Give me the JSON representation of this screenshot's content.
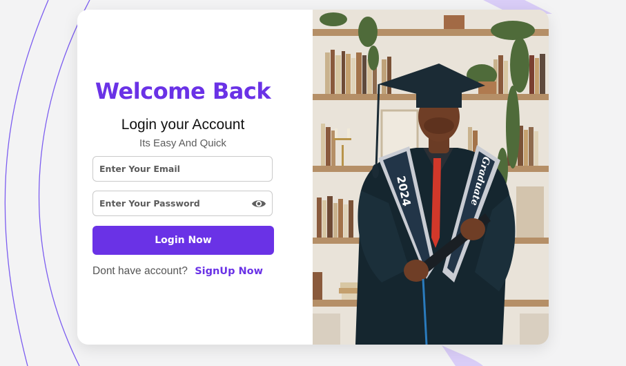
{
  "login": {
    "title": "Welcome Back",
    "subtitle": "Login your Account",
    "tagline": "Its Easy And Quick",
    "email_placeholder": "Enter Your Email",
    "password_placeholder": "Enter Your Password",
    "login_button": "Login Now",
    "no_account_text": "Dont have account?",
    "signup_link": "SignUp Now"
  },
  "photo": {
    "sash_year": "2024",
    "sash_word": "Graduate"
  },
  "colors": {
    "accent": "#6a32e6",
    "background": "#f3f3f4",
    "card": "#ffffff"
  },
  "icons": {
    "password_toggle": "eye-icon"
  }
}
